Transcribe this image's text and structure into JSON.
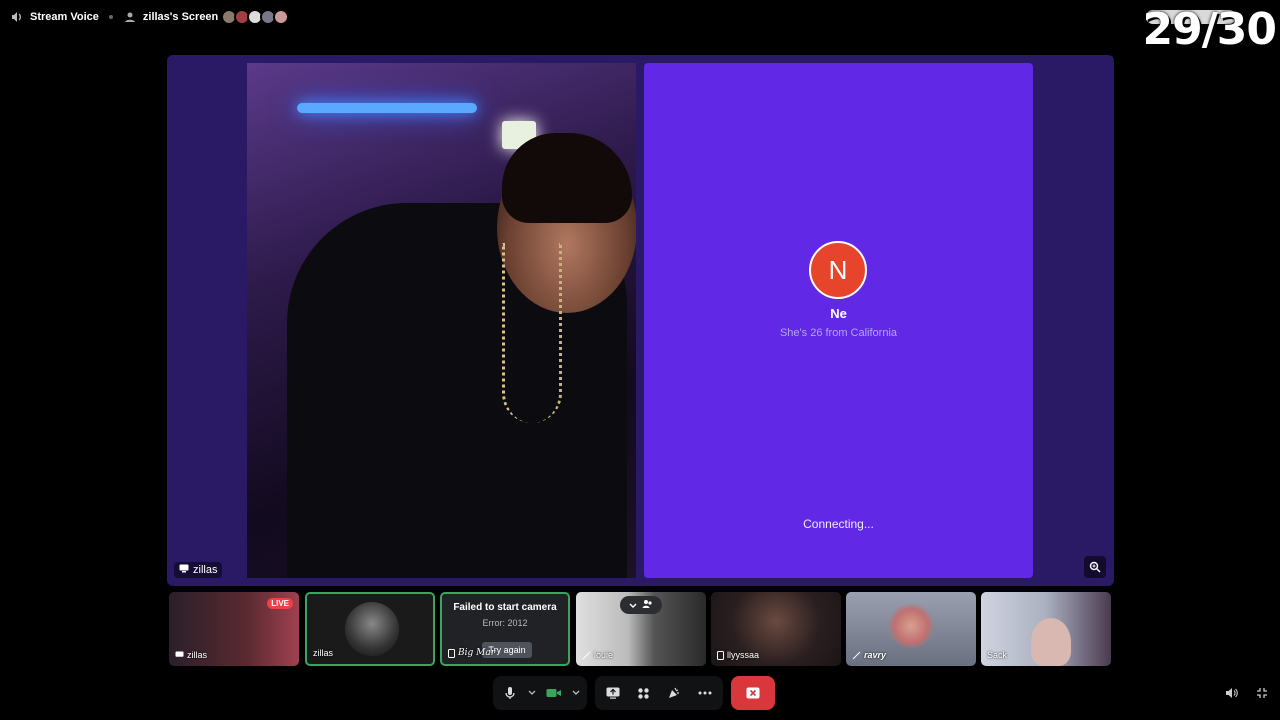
{
  "topbar": {
    "channel": "Stream Voice",
    "screen_title": "zillas's Screen"
  },
  "counter": "29/30",
  "main_stage": {
    "left_tile": {
      "name": "zillas"
    },
    "right_tile": {
      "avatar_letter": "N",
      "name": "Ne",
      "subtitle": "She's 26 from California",
      "status": "Connecting..."
    }
  },
  "participants": [
    {
      "name": "zillas",
      "badge": "LIVE"
    },
    {
      "name": "zillas"
    },
    {
      "error_title": "Failed to start camera",
      "error_code": "Error: 2012",
      "button": "Try again",
      "name": "Big Mar"
    },
    {
      "name": "louie"
    },
    {
      "name": "llyyssaa"
    },
    {
      "name": "ravry"
    },
    {
      "name": "Sack"
    }
  ],
  "colors": {
    "stage_bg": "#2a1a66",
    "right_tile_bg": "#6128e6",
    "avatar_bg": "#e6452c",
    "hangup": "#da373c",
    "live_badge": "#ed4245",
    "selected_border": "#3ba55d"
  }
}
